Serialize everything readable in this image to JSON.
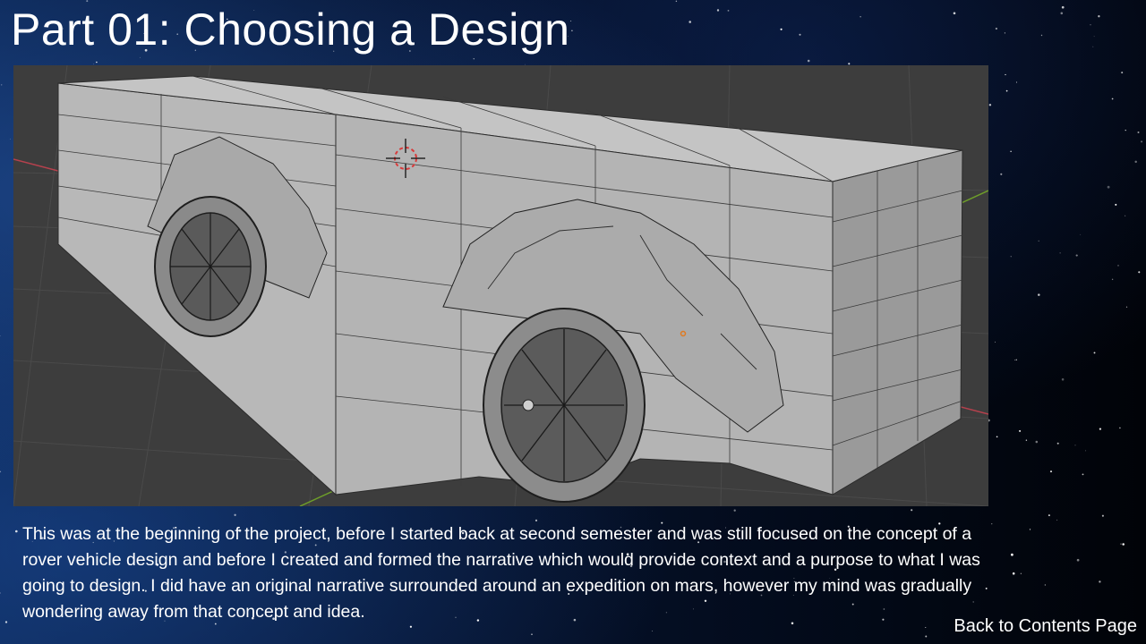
{
  "slide": {
    "title": "Part 01: Choosing a Design",
    "caption": "This was at the beginning of the project, before I started back at second semester and was still focused on the concept of a rover vehicle design and before I created and formed the narrative which would provide context and a purpose to what I was going to design. I did have an original narrative surrounded around an expedition on mars, however my mind was gradually wondering away from that concept and idea.",
    "back_link": "Back to Contents Page"
  },
  "viewport": {
    "background_color": "#3d3d3d",
    "model_color": "#b4b4b4",
    "x_axis_color": "#b5414d",
    "y_axis_color": "#6e9e2a",
    "cursor_icon": "3d-cursor-icon",
    "origin_icon": "object-origin-icon"
  }
}
